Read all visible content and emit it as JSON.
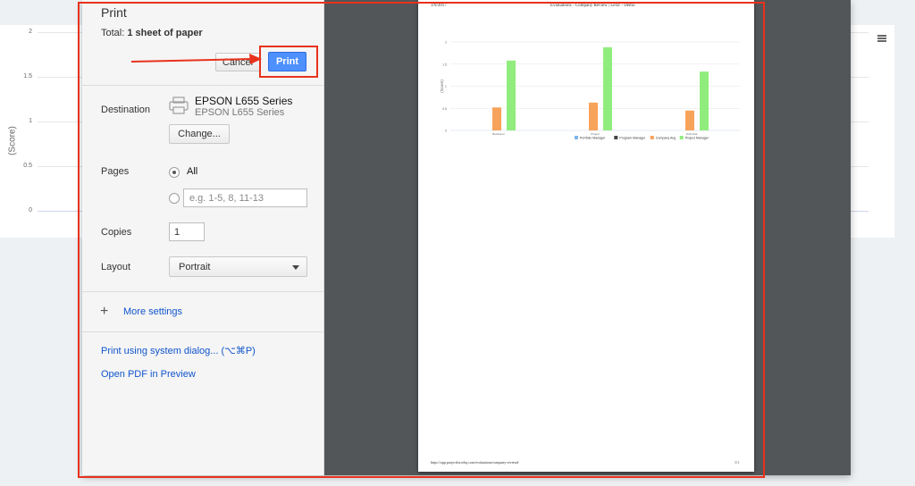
{
  "background": {
    "y_ticks": [
      "2",
      "1.5",
      "1",
      "0.5",
      "0"
    ],
    "y_label": "(Score)"
  },
  "dialog": {
    "title": "Print",
    "total_prefix": "Total:",
    "total_value": "1 sheet of paper",
    "cancel_label": "Cancel",
    "print_label": "Print",
    "destination": {
      "label": "Destination",
      "printer_name": "EPSON L655 Series",
      "printer_sub": "EPSON L655 Series",
      "change_label": "Change..."
    },
    "pages": {
      "label": "Pages",
      "option_all": "All",
      "range_placeholder": "e.g. 1-5, 8, 11-13"
    },
    "copies": {
      "label": "Copies",
      "value": "1"
    },
    "layout": {
      "label": "Layout",
      "value": "Portrait"
    },
    "more_settings": "More settings",
    "system_dialog_link": "Print using system dialog... (⌥⌘P)",
    "open_pdf_link": "Open PDF in Preview"
  },
  "preview": {
    "header_date": "3/9/2017",
    "header_title": "Evaluations - Company Review | Lexir - Demo",
    "footer_url": "https://app.projectforcehq.com/evaluations/company-review#",
    "footer_page": "1/1"
  },
  "chart_data": {
    "type": "bar",
    "categories": [
      "Behaviour",
      "Project",
      "Technical"
    ],
    "y_ticks": [
      "2",
      "1.5",
      "1",
      "0.5",
      "0"
    ],
    "ylabel": "(Score)",
    "ylim": [
      0,
      2
    ],
    "series": [
      {
        "name": "Portfolio Manager",
        "color": "#7cb5ec",
        "values": [
          0,
          0,
          0
        ]
      },
      {
        "name": "Program Manager",
        "color": "#434348",
        "values": [
          0,
          0,
          0
        ]
      },
      {
        "name": "Company Avg",
        "color": "#f7a35c",
        "values": [
          0.52,
          0.63,
          0.45
        ]
      },
      {
        "name": "Project Manager",
        "color": "#90ed7d",
        "values": [
          1.58,
          1.88,
          1.33
        ]
      }
    ],
    "legend_position": "bottom-right"
  },
  "colors": {
    "print_button": "#4d90fe",
    "link": "#1155cc",
    "annotation": "#e8321d",
    "preview_bg": "#525659"
  }
}
